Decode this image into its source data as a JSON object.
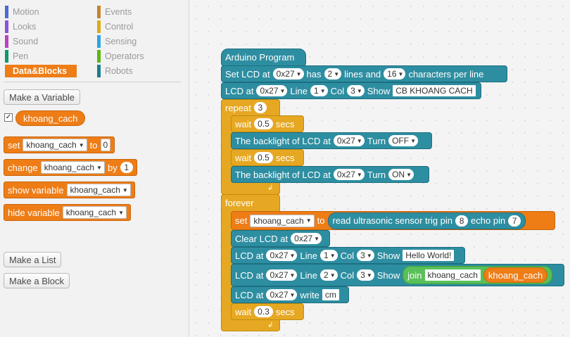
{
  "categories_left": [
    {
      "label": "Motion",
      "color": "#4a6cd4"
    },
    {
      "label": "Looks",
      "color": "#8a55d7"
    },
    {
      "label": "Sound",
      "color": "#bb42c3"
    },
    {
      "label": "Pen",
      "color": "#0e9a6c"
    },
    {
      "label": "Data&Blocks",
      "color": "#ee7d16",
      "active": true
    }
  ],
  "categories_right": [
    {
      "label": "Events",
      "color": "#c88330"
    },
    {
      "label": "Control",
      "color": "#e1a91a"
    },
    {
      "label": "Sensing",
      "color": "#2ca5e2"
    },
    {
      "label": "Operators",
      "color": "#5cb712"
    },
    {
      "label": "Robots",
      "color": "#1b7d8f"
    }
  ],
  "palette": {
    "make_variable": "Make a Variable",
    "variable_name": "khoang_cach",
    "checkbox_mark": "✓",
    "set_label": "set",
    "set_var": "khoang_cach",
    "set_to": "to",
    "set_value": "0",
    "change_label": "change",
    "change_var": "khoang_cach",
    "change_by": "by",
    "change_value": "1",
    "show_label": "show variable",
    "show_var": "khoang_cach",
    "hide_label": "hide variable",
    "hide_var": "khoang_cach",
    "make_list": "Make a List",
    "make_block": "Make a Block"
  },
  "script": {
    "hat": "Arduino Program",
    "set_lcd": {
      "a": "Set LCD at",
      "addr": "0x27",
      "b": "has",
      "lines": "2",
      "c": "lines and",
      "chars": "16",
      "d": "characters per line"
    },
    "lcd1": {
      "a": "LCD at",
      "addr": "0x27",
      "b": "Line",
      "line": "1",
      "c": "Col",
      "col": "3",
      "d": "Show",
      "text": "CB KHOANG CACH"
    },
    "repeat": {
      "label": "repeat",
      "count": "3"
    },
    "wait1": {
      "a": "wait",
      "val": "0.5",
      "b": "secs"
    },
    "backlight1": {
      "a": "The backlight of LCD at",
      "addr": "0x27",
      "b": "Turn",
      "state": "OFF"
    },
    "wait2": {
      "a": "wait",
      "val": "0.5",
      "b": "secs"
    },
    "backlight2": {
      "a": "The backlight of LCD at",
      "addr": "0x27",
      "b": "Turn",
      "state": "ON"
    },
    "forever": "forever",
    "set_block": {
      "a": "set",
      "var": "khoang_cach",
      "b": "to",
      "sensor": "read ultrasonic sensor trig pin",
      "trig": "8",
      "echo_label": "echo pin",
      "echo": "7"
    },
    "clear": {
      "a": "Clear LCD at",
      "addr": "0x27"
    },
    "lcd2": {
      "a": "LCD at",
      "addr": "0x27",
      "b": "Line",
      "line": "1",
      "c": "Col",
      "col": "3",
      "d": "Show",
      "text": "Hello World!"
    },
    "lcd3": {
      "a": "LCD at",
      "addr": "0x27",
      "b": "Line",
      "line": "2",
      "c": "Col",
      "col": "3",
      "d": "Show",
      "join": "join",
      "join_text": "khoang_cach",
      "join_var": "khoang_cach"
    },
    "lcd4": {
      "a": "LCD at",
      "addr": "0x27",
      "b": "write",
      "text": "cm"
    },
    "wait3": {
      "a": "wait",
      "val": "0.3",
      "b": "secs"
    }
  }
}
